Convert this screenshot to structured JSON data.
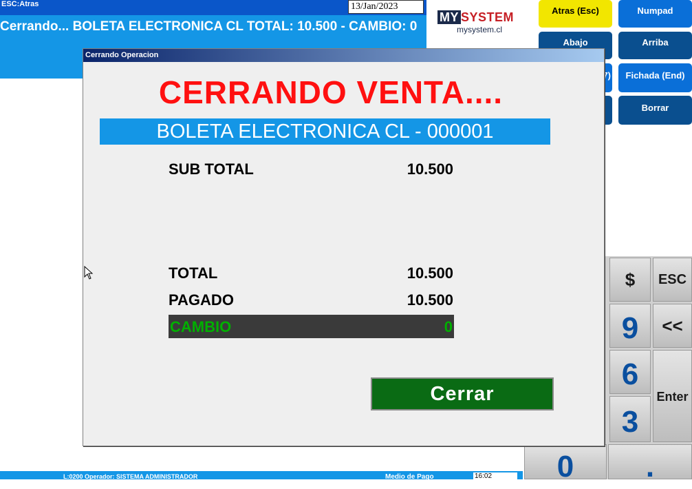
{
  "header": {
    "esc_hint": "ESC:Atras",
    "date": "13/Jan/2023",
    "status_text": "Cerrando... BOLETA ELECTRONICA CL TOTAL: 10.500 - CAMBIO: 0"
  },
  "logo": {
    "url": "mysystem.cl"
  },
  "right_buttons": {
    "atras": "Atras (Esc)",
    "numpad": "Numpad",
    "abajo": "Abajo",
    "arriba": "Arriba",
    "fichada": "Fichada (End)",
    "borrar": "Borrar",
    "partial_7": "7)"
  },
  "keypad": {
    "dollar": "$",
    "esc": "ESC",
    "nine": "9",
    "back": "<<",
    "six": "6",
    "enter": "Enter",
    "three": "3",
    "zero": "0"
  },
  "taskbar": {
    "operator": "L:0200 Operador: SISTEMA ADMINISTRADOR",
    "medio_pago": "Medio de Pago",
    "time": "16:02"
  },
  "dialog": {
    "title": "Cerrando Operacion",
    "heading": "CERRANDO VENTA....",
    "document": "BOLETA ELECTRONICA CL - 000001",
    "subtotal_label": "SUB TOTAL",
    "subtotal_value": "10.500",
    "total_label": "TOTAL",
    "total_value": "10.500",
    "pagado_label": "PAGADO",
    "pagado_value": "10.500",
    "cambio_label": "CAMBIO",
    "cambio_value": "0",
    "close_label": "Cerrar"
  }
}
